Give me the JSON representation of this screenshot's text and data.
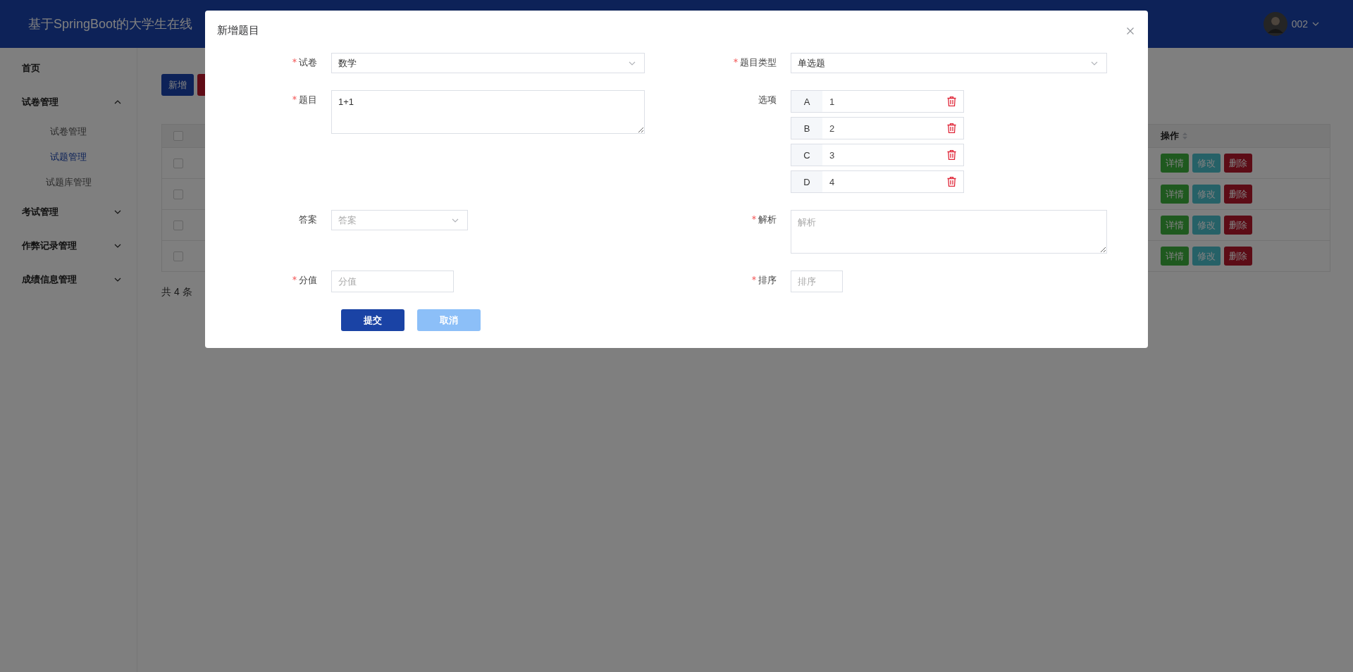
{
  "header": {
    "title": "基于SpringBoot的大学生在线",
    "user": "002"
  },
  "sidebar": [
    {
      "label": "首页",
      "kind": "link"
    },
    {
      "label": "试卷管理",
      "kind": "group",
      "expanded": true,
      "children": [
        {
          "label": "试卷管理",
          "selected": false
        },
        {
          "label": "试题管理",
          "selected": true
        },
        {
          "label": "试题库管理",
          "selected": false
        }
      ]
    },
    {
      "label": "考试管理",
      "kind": "group",
      "expanded": false
    },
    {
      "label": "作弊记录管理",
      "kind": "group",
      "expanded": false
    },
    {
      "label": "成绩信息管理",
      "kind": "group",
      "expanded": false
    }
  ],
  "toolbar": [
    {
      "label": "新增",
      "kind": "primary"
    },
    {
      "kind": "danger"
    }
  ],
  "table": {
    "header_checked": false,
    "actions_heading": "操作",
    "rows": [
      {
        "checked": false,
        "actions": [
          {
            "label": "详情",
            "kind": "detail"
          },
          {
            "label": "修改",
            "kind": "edit"
          },
          {
            "label": "删除",
            "kind": "delete"
          }
        ]
      },
      {
        "checked": false,
        "actions": [
          {
            "label": "详情",
            "kind": "detail"
          },
          {
            "label": "修改",
            "kind": "edit"
          },
          {
            "label": "删除",
            "kind": "delete"
          }
        ]
      },
      {
        "checked": false,
        "actions": [
          {
            "label": "详情",
            "kind": "detail"
          },
          {
            "label": "修改",
            "kind": "edit"
          },
          {
            "label": "删除",
            "kind": "delete"
          }
        ]
      },
      {
        "checked": false,
        "actions": [
          {
            "label": "详情",
            "kind": "detail"
          },
          {
            "label": "修改",
            "kind": "edit"
          },
          {
            "label": "删除",
            "kind": "delete"
          }
        ]
      }
    ],
    "total": "共 4 条"
  },
  "dialog": {
    "title": "新增题目",
    "rows": [
      [
        {
          "label": "试卷",
          "required": true,
          "kind": "select",
          "value": "数学"
        },
        {
          "label": "题目类型",
          "required": true,
          "kind": "select",
          "value": "单选题"
        }
      ],
      [
        {
          "label": "题目",
          "required": true,
          "kind": "textarea",
          "value": "1+1"
        },
        {
          "label": "选项",
          "required": false,
          "kind": "options",
          "options": [
            {
              "letter": "A",
              "value": "1"
            },
            {
              "letter": "B",
              "value": "2"
            },
            {
              "letter": "C",
              "value": "3"
            },
            {
              "letter": "D",
              "value": "4"
            }
          ]
        }
      ],
      [
        {
          "label": "答案",
          "required": false,
          "kind": "select",
          "placeholder": "答案"
        },
        {
          "label": "解析",
          "required": true,
          "kind": "textarea",
          "placeholder": "解析"
        }
      ],
      [
        {
          "label": "分值",
          "required": true,
          "kind": "input",
          "placeholder": "分值"
        },
        {
          "label": "排序",
          "required": true,
          "kind": "input",
          "placeholder": "排序"
        }
      ]
    ],
    "buttons": [
      {
        "label": "提交",
        "kind": "primary"
      },
      {
        "label": "取消",
        "kind": "secondary"
      }
    ]
  }
}
